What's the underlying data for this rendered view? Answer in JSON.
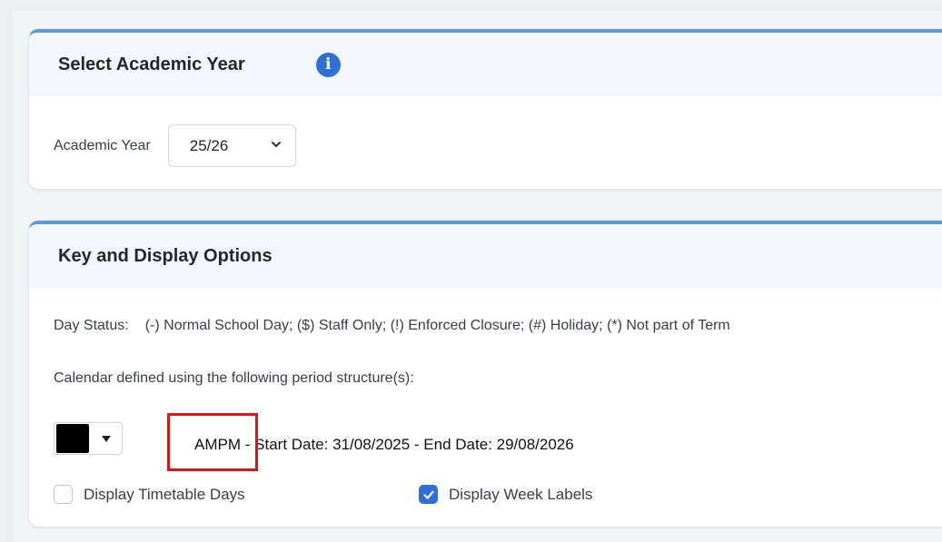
{
  "colors": {
    "accent": "#5b9bd5",
    "info": "#2f6fd8",
    "highlight_box": "#e0151a",
    "swatch": "#000000"
  },
  "year_panel": {
    "title": "Select Academic Year",
    "info_icon": "info-circle-icon",
    "academic_year_label": "Academic Year",
    "academic_year_value": "25/26"
  },
  "key_panel": {
    "title": "Key and Display Options",
    "day_status_label": "Day Status:",
    "day_status_text": "(-) Normal School Day; ($) Staff Only; (!) Enforced Closure; (#) Holiday; (*) Not part of Term",
    "structure_intro": "Calendar defined using the following period structure(s):",
    "structure_name": "AMPM",
    "structure_separator": "-",
    "structure_dates": "Start Date: 31/08/2025 - End Date: 29/08/2026",
    "display_timetable_days": {
      "label": "Display Timetable Days",
      "checked": false
    },
    "display_week_labels": {
      "label": "Display Week Labels",
      "checked": true
    }
  }
}
